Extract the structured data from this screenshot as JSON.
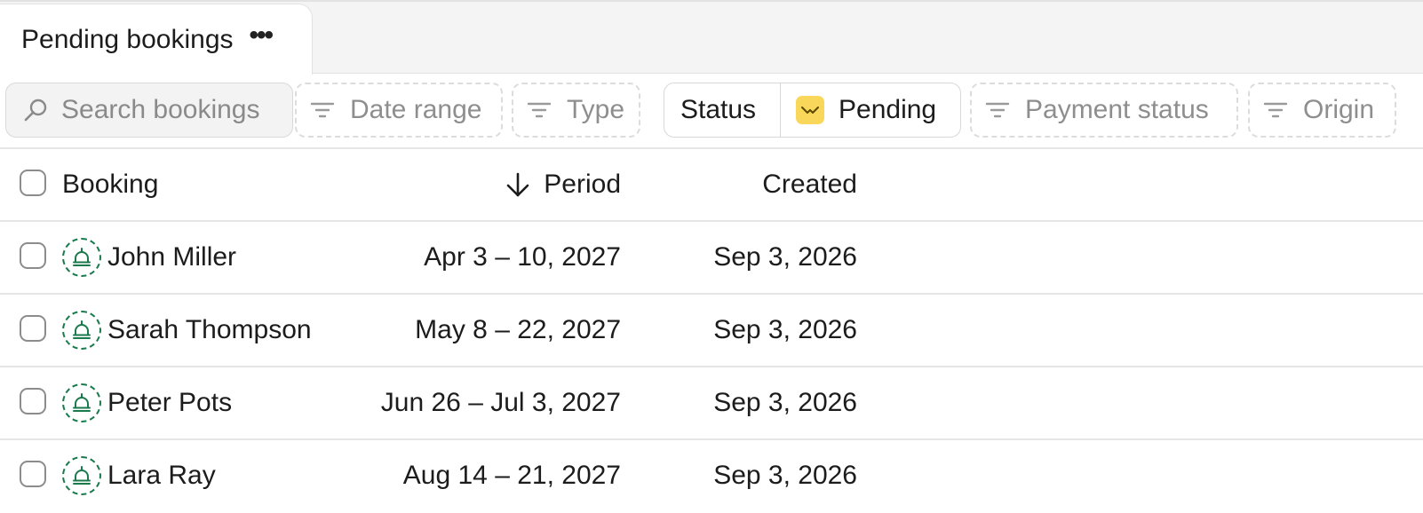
{
  "tab": {
    "label": "Pending bookings",
    "more": "•••"
  },
  "filters": {
    "search_placeholder": "Search bookings",
    "date_range": "Date range",
    "type": "Type",
    "status_label": "Status",
    "status_value": "Pending",
    "payment_status": "Payment status",
    "origin": "Origin"
  },
  "table": {
    "headers": {
      "booking": "Booking",
      "period": "Period",
      "created": "Created"
    },
    "rows": [
      {
        "name": "John Miller",
        "period": "Apr 3 – 10, 2027",
        "created": "Sep 3, 2026"
      },
      {
        "name": "Sarah Thompson",
        "period": "May 8 – 22, 2027",
        "created": "Sep 3, 2026"
      },
      {
        "name": "Peter Pots",
        "period": "Jun 26 – Jul 3, 2027",
        "created": "Sep 3, 2026"
      },
      {
        "name": "Lara Ray",
        "period": "Aug 14 – 21, 2027",
        "created": "Sep 3, 2026"
      }
    ]
  },
  "colors": {
    "accent_green": "#1a7a4e",
    "pending_yellow": "#f9d75b"
  },
  "icons": [
    "more-icon",
    "search-icon",
    "filter-icon",
    "pending-icon",
    "sort-down-icon",
    "bell-icon"
  ]
}
